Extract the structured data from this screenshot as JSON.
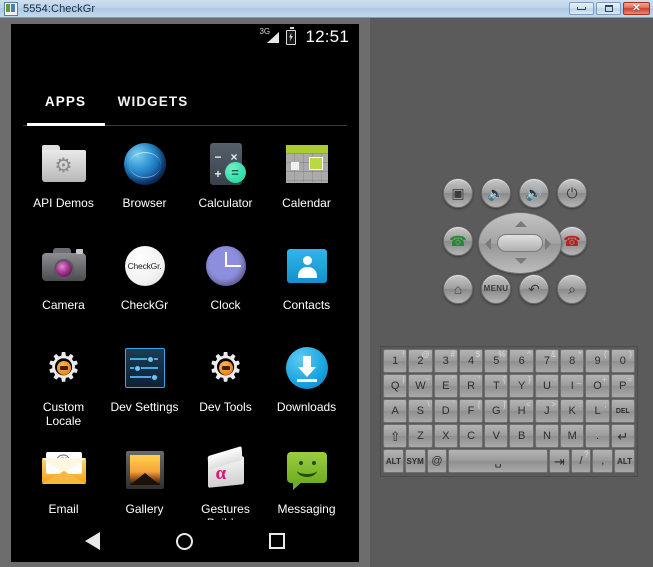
{
  "window": {
    "title": "5554:CheckGr",
    "icon": "app-icon",
    "buttons": {
      "minimize": "minimize",
      "maximize": "maximize",
      "close": "✕"
    }
  },
  "device": {
    "status_bar": {
      "network_type": "3G",
      "signal_icon": "signal-bars-icon",
      "battery_icon": "battery-charging-icon",
      "time": "12:51"
    },
    "tabs": [
      {
        "label": "APPS",
        "selected": true
      },
      {
        "label": "WIDGETS",
        "selected": false
      }
    ],
    "apps": [
      {
        "label": "API Demos",
        "icon": "api-demos-icon"
      },
      {
        "label": "Browser",
        "icon": "browser-icon"
      },
      {
        "label": "Calculator",
        "icon": "calculator-icon"
      },
      {
        "label": "Calendar",
        "icon": "calendar-icon"
      },
      {
        "label": "Camera",
        "icon": "camera-icon"
      },
      {
        "label": "CheckGr",
        "icon": "checkgr-icon",
        "icon_text": "CheckGr."
      },
      {
        "label": "Clock",
        "icon": "clock-icon"
      },
      {
        "label": "Contacts",
        "icon": "contacts-icon"
      },
      {
        "label": "Custom\nLocale",
        "icon": "custom-locale-icon"
      },
      {
        "label": "Dev Settings",
        "icon": "dev-settings-icon"
      },
      {
        "label": "Dev Tools",
        "icon": "dev-tools-icon"
      },
      {
        "label": "Downloads",
        "icon": "downloads-icon"
      },
      {
        "label": "Email",
        "icon": "email-icon"
      },
      {
        "label": "Gallery",
        "icon": "gallery-icon"
      },
      {
        "label": "Gestures\nBuilder",
        "icon": "gestures-builder-icon"
      },
      {
        "label": "Messaging",
        "icon": "messaging-icon"
      }
    ],
    "nav_bar": {
      "back": "back-icon",
      "home": "home-icon",
      "recents": "recents-icon"
    }
  },
  "controls": {
    "hardware_buttons": [
      {
        "name": "camera-button",
        "glyph": "▣"
      },
      {
        "name": "volume-down-button",
        "glyph": "🔉"
      },
      {
        "name": "volume-up-button",
        "glyph": "🔊"
      },
      {
        "name": "power-button",
        "glyph": "⏻"
      },
      {
        "name": "call-button",
        "glyph": "✆"
      },
      {
        "name": "end-call-button",
        "glyph": "✆"
      },
      {
        "name": "home-button",
        "glyph": "⌂"
      },
      {
        "name": "menu-button",
        "glyph": "MENU"
      },
      {
        "name": "back-button",
        "glyph": "↶"
      },
      {
        "name": "search-button",
        "glyph": "⌕"
      }
    ],
    "dpad": {
      "up": "▲",
      "down": "▼",
      "left": "◀",
      "right": "▶",
      "center": "select"
    }
  },
  "keyboard": {
    "rows": [
      [
        {
          "main": "1",
          "alt": "!"
        },
        {
          "main": "2",
          "alt": "@"
        },
        {
          "main": "3",
          "alt": "#"
        },
        {
          "main": "4",
          "alt": "$"
        },
        {
          "main": "5",
          "alt": "%"
        },
        {
          "main": "6",
          "alt": "^"
        },
        {
          "main": "7",
          "alt": "&"
        },
        {
          "main": "8",
          "alt": "*"
        },
        {
          "main": "9",
          "alt": "("
        },
        {
          "main": "0",
          "alt": ")"
        }
      ],
      [
        {
          "main": "Q",
          "alt": "|"
        },
        {
          "main": "W",
          "alt": "~"
        },
        {
          "main": "E",
          "alt": "\""
        },
        {
          "main": "R",
          "alt": "'"
        },
        {
          "main": "T",
          "alt": "{"
        },
        {
          "main": "Y",
          "alt": "}"
        },
        {
          "main": "U",
          "alt": "-"
        },
        {
          "main": "I",
          "alt": "_"
        },
        {
          "main": "O",
          "alt": "+"
        },
        {
          "main": "P",
          "alt": "="
        }
      ],
      [
        {
          "main": "A",
          "alt": ""
        },
        {
          "main": "S",
          "alt": "\\"
        },
        {
          "main": "D",
          "alt": "`"
        },
        {
          "main": "F",
          "alt": "["
        },
        {
          "main": "G",
          "alt": "]"
        },
        {
          "main": "H",
          "alt": "<"
        },
        {
          "main": "J",
          "alt": ">"
        },
        {
          "main": "K",
          "alt": ":"
        },
        {
          "main": "L",
          "alt": ";"
        },
        {
          "main": "DEL",
          "alt": ""
        }
      ],
      [
        {
          "main": "⇧",
          "alt": ""
        },
        {
          "main": "Z",
          "alt": ""
        },
        {
          "main": "X",
          "alt": ""
        },
        {
          "main": "C",
          "alt": ""
        },
        {
          "main": "V",
          "alt": ""
        },
        {
          "main": "B",
          "alt": ""
        },
        {
          "main": "N",
          "alt": ""
        },
        {
          "main": "M",
          "alt": ""
        },
        {
          "main": ".",
          "alt": ""
        },
        {
          "main": "↵",
          "alt": ""
        }
      ],
      [
        {
          "main": "ALT",
          "alt": ""
        },
        {
          "main": "SYM",
          "alt": ""
        },
        {
          "main": "@",
          "alt": ""
        },
        {
          "main": "␣",
          "alt": ""
        },
        {
          "main": "⇥",
          "alt": ""
        },
        {
          "main": "/",
          "alt": "?"
        },
        {
          "main": ",",
          "alt": ""
        },
        {
          "main": "ALT",
          "alt": ""
        }
      ]
    ]
  }
}
